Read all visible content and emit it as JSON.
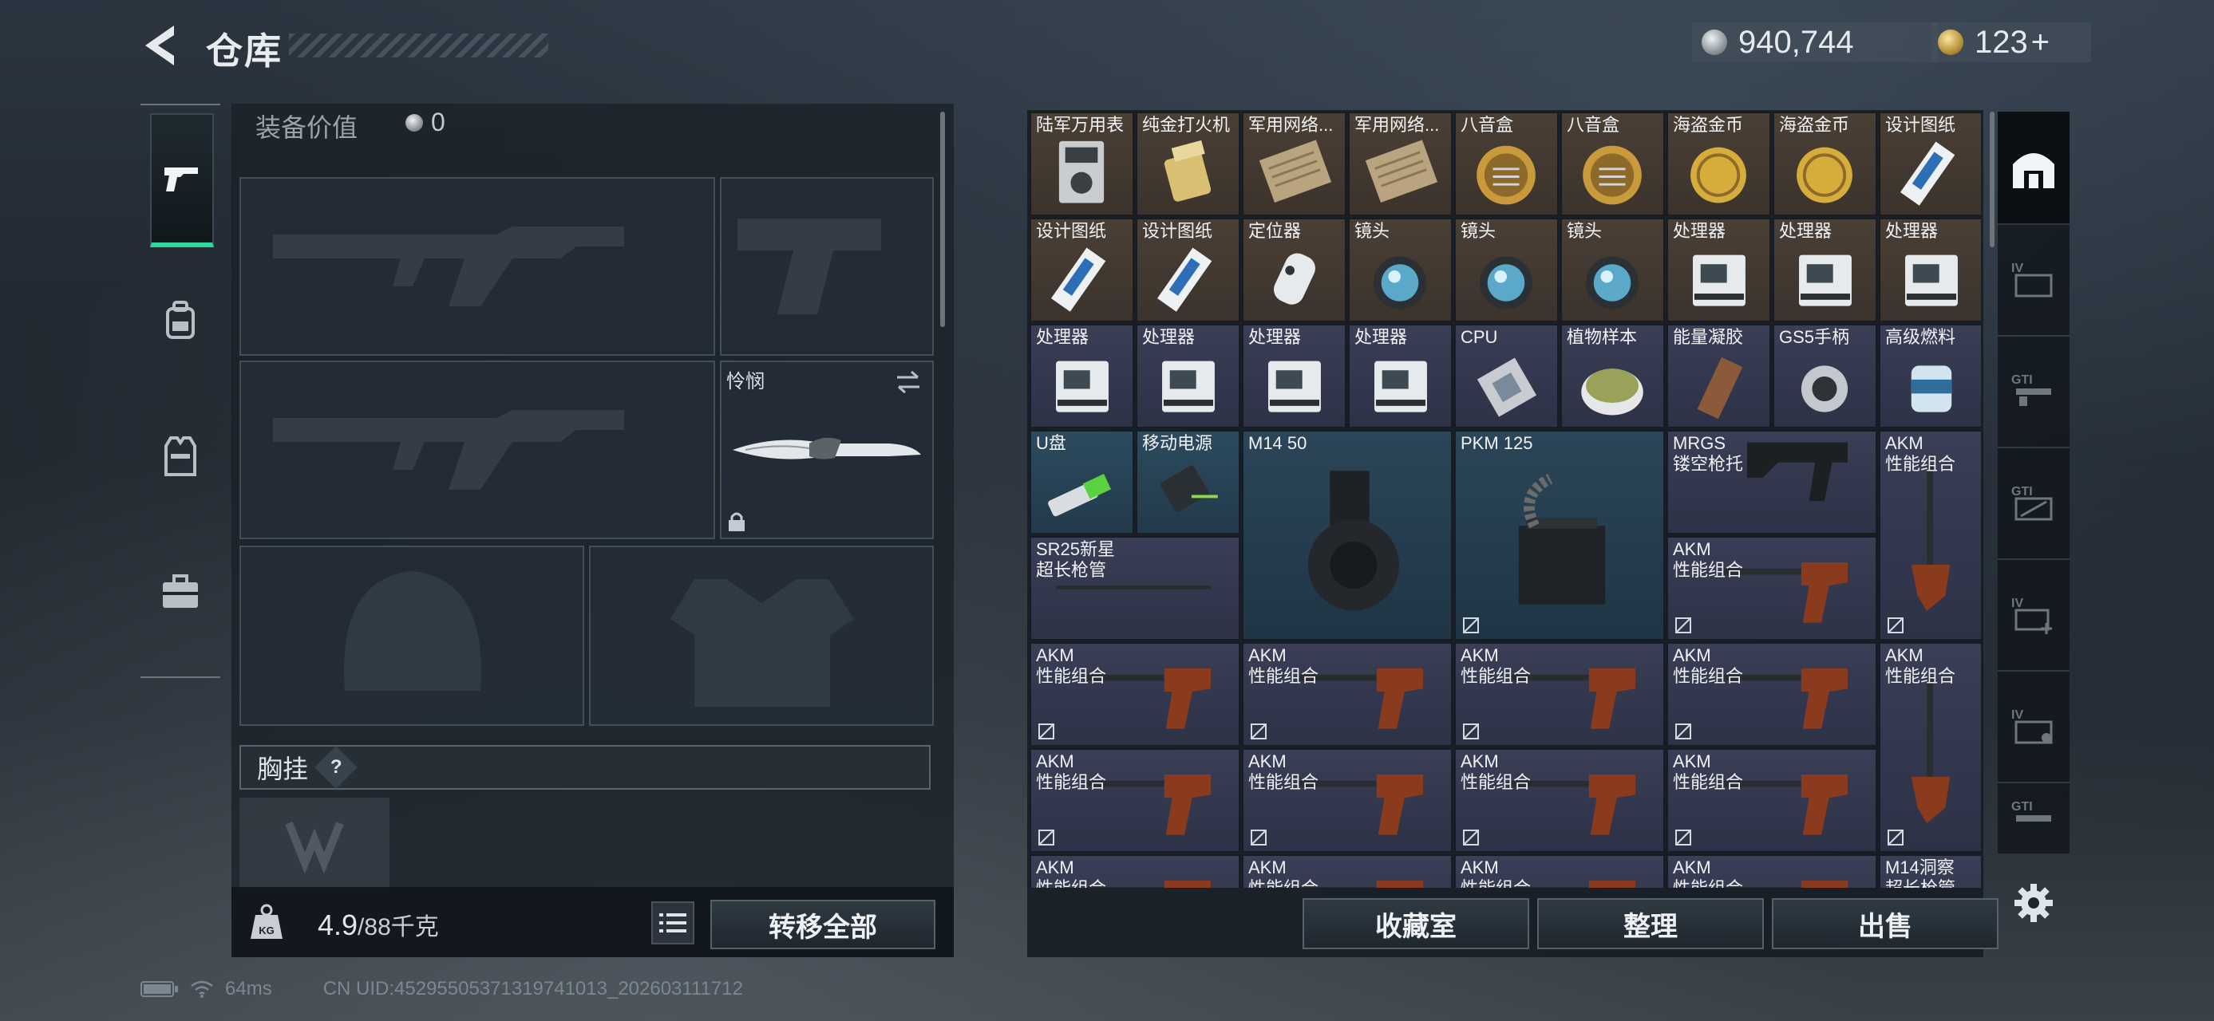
{
  "header": {
    "title": "仓库",
    "currency_silver": "940,744",
    "currency_gold": "123",
    "gold_plus": "+"
  },
  "left_nav": {
    "items": [
      {
        "name": "weapon",
        "icon": "pistol-icon"
      },
      {
        "name": "backpack",
        "icon": "backpack-icon"
      },
      {
        "name": "vest",
        "icon": "vest-icon"
      },
      {
        "name": "case",
        "icon": "briefcase-icon"
      }
    ]
  },
  "equipment": {
    "value_label": "装备价值",
    "value": "0",
    "melee_label": "怜悯",
    "chest_rig_label": "胸挂",
    "help_label": "?"
  },
  "bottom_left": {
    "weight_current": "4.9",
    "weight_max": "/88千克",
    "transfer_all": "转移全部"
  },
  "inventory": {
    "cells": [
      {
        "name": "陆军万用表",
        "rarity": "brown"
      },
      {
        "name": "纯金打火机",
        "rarity": "brown"
      },
      {
        "name": "军用网络...",
        "rarity": "brown"
      },
      {
        "name": "军用网络...",
        "rarity": "brown"
      },
      {
        "name": "八音盒",
        "rarity": "brown"
      },
      {
        "name": "八音盒",
        "rarity": "brown"
      },
      {
        "name": "海盗金币",
        "rarity": "brown"
      },
      {
        "name": "海盗金币",
        "rarity": "brown"
      },
      {
        "name": "设计图纸",
        "rarity": "brown"
      },
      {
        "name": "设计图纸",
        "rarity": "brown"
      },
      {
        "name": "设计图纸",
        "rarity": "brown"
      },
      {
        "name": "定位器",
        "rarity": "brown"
      },
      {
        "name": "镜头",
        "rarity": "brown"
      },
      {
        "name": "镜头",
        "rarity": "brown"
      },
      {
        "name": "镜头",
        "rarity": "brown"
      },
      {
        "name": "处理器",
        "rarity": "brown"
      },
      {
        "name": "处理器",
        "rarity": "brown"
      },
      {
        "name": "处理器",
        "rarity": "brown"
      },
      {
        "name": "处理器",
        "rarity": "purple"
      },
      {
        "name": "处理器",
        "rarity": "purple"
      },
      {
        "name": "处理器",
        "rarity": "purple"
      },
      {
        "name": "处理器",
        "rarity": "purple"
      },
      {
        "name": "CPU",
        "rarity": "purple"
      },
      {
        "name": "植物样本",
        "rarity": "purple"
      },
      {
        "name": "能量凝胶",
        "rarity": "purple"
      },
      {
        "name": "GS5手柄",
        "rarity": "purple"
      },
      {
        "name": "高级燃料",
        "rarity": "purple"
      }
    ],
    "usb": "U盘",
    "powerbank": "移动电源",
    "m14_mag": "M14 50",
    "pkm_mag": "PKM 125",
    "mrgs": "MRGS",
    "mrgs_sub": "镂空枪托",
    "akm": "AKM",
    "akm_sub": "性能组合",
    "sr25": "SR25新星",
    "sr25_sub": "超长枪管",
    "m14_kit": "M14洞察",
    "m14_kit_sub": "超长枪管"
  },
  "actions": {
    "collection": "收藏室",
    "sort": "整理",
    "sell": "出售"
  },
  "footer": {
    "ping": "64ms",
    "uid": "CN UID:452955053713197410​13_202603111712"
  },
  "colors": {
    "accent": "#2fd89a",
    "rarity_brown": "#4a3f35",
    "rarity_purple": "#3a3e56",
    "rarity_blue": "#2d4a5e"
  }
}
